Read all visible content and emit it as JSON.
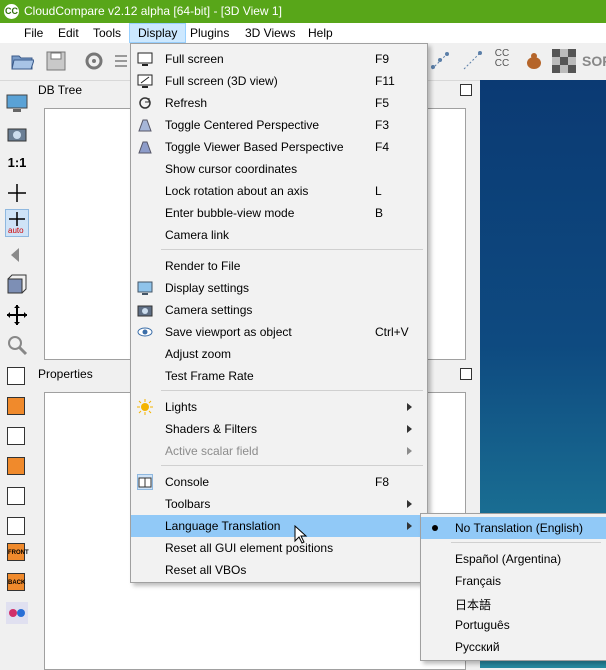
{
  "window": {
    "title": "CloudCompare v2.12 alpha [64-bit] - [3D View 1]",
    "logo_text": "CC"
  },
  "menubar": [
    "File",
    "Edit",
    "Tools",
    "Display",
    "Plugins",
    "3D Views",
    "Help"
  ],
  "toolbar_right": {
    "cc_text": "CC CC",
    "sor_text": "SOR"
  },
  "left_toolbar": {
    "ratio_label": "1:1",
    "auto_label": "auto",
    "front_label": "FRONT",
    "back_label": "BACK"
  },
  "panels": {
    "db_tree": "DB Tree",
    "properties": "Properties"
  },
  "display_menu": {
    "items": [
      {
        "label": "Full screen",
        "shortcut": "F9",
        "icon": "monitor-icon"
      },
      {
        "label": "Full screen (3D view)",
        "shortcut": "F11",
        "icon": "monitor-3d-icon"
      },
      {
        "label": "Refresh",
        "shortcut": "F5",
        "icon": "refresh-icon"
      },
      {
        "label": "Toggle Centered Perspective",
        "shortcut": "F3",
        "icon": "perspective-icon"
      },
      {
        "label": "Toggle Viewer Based Perspective",
        "shortcut": "F4",
        "icon": "viewer-perspective-icon"
      },
      {
        "label": "Show cursor coordinates",
        "shortcut": ""
      },
      {
        "label": "Lock rotation about an axis",
        "shortcut": "L"
      },
      {
        "label": "Enter bubble-view mode",
        "shortcut": "B"
      },
      {
        "label": "Camera link",
        "shortcut": ""
      },
      {
        "label": "Render to File",
        "shortcut": ""
      },
      {
        "label": "Display settings",
        "shortcut": "",
        "icon": "display-settings-icon"
      },
      {
        "label": "Camera settings",
        "shortcut": "",
        "icon": "camera-icon"
      },
      {
        "label": "Save viewport as object",
        "shortcut": "Ctrl+V",
        "icon": "eye-icon"
      },
      {
        "label": "Adjust zoom",
        "shortcut": ""
      },
      {
        "label": "Test Frame Rate",
        "shortcut": ""
      },
      {
        "label": "Lights",
        "submenu": true,
        "icon": "sun-icon"
      },
      {
        "label": "Shaders & Filters",
        "submenu": true
      },
      {
        "label": "Active scalar field",
        "submenu": true,
        "disabled": true
      },
      {
        "label": "Console",
        "shortcut": "F8",
        "icon": "console-icon"
      },
      {
        "label": "Toolbars",
        "submenu": true
      },
      {
        "label": "Language Translation",
        "submenu": true,
        "highlighted": true
      },
      {
        "label": "Reset all GUI element positions",
        "shortcut": ""
      },
      {
        "label": "Reset all VBOs",
        "shortcut": ""
      }
    ]
  },
  "language_menu": {
    "items": [
      {
        "label": "No Translation (English)",
        "checked": true
      },
      {
        "label": "Español (Argentina)"
      },
      {
        "label": "Français"
      },
      {
        "label": "日本語"
      },
      {
        "label": "Português"
      },
      {
        "label": "Русский"
      }
    ]
  },
  "colors": {
    "titlebar": "#58a619",
    "highlight": "#91c9f7",
    "view_top": "#0b3a73",
    "view_bottom": "#268aa0"
  }
}
